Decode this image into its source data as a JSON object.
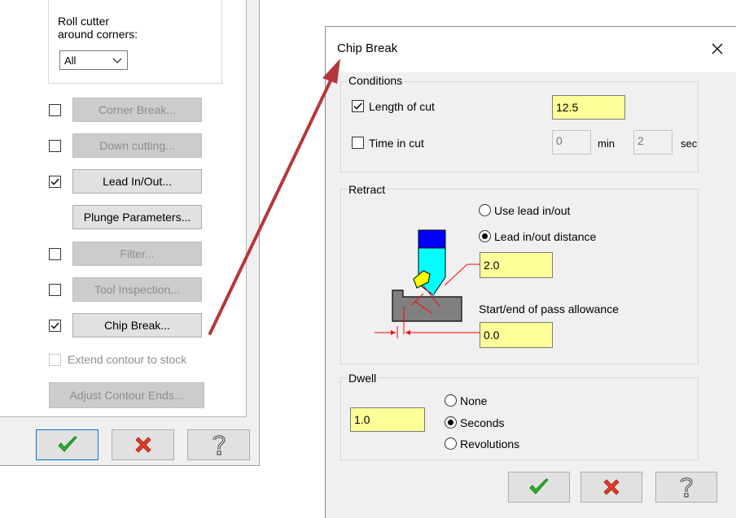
{
  "left_panel": {
    "roll_cutter_label": "Roll cutter\naround corners:",
    "roll_cutter_value": "All",
    "options": [
      {
        "label": "Corner Break...",
        "checked": false,
        "enabled": false
      },
      {
        "label": "Down cutting...",
        "checked": false,
        "enabled": false
      },
      {
        "label": "Lead In/Out...",
        "checked": true,
        "enabled": true
      },
      {
        "label": "Plunge Parameters...",
        "enabled": true
      },
      {
        "label": "Filter...",
        "checked": false,
        "enabled": false
      },
      {
        "label": "Tool Inspection...",
        "checked": false,
        "enabled": false
      },
      {
        "label": "Chip Break...",
        "checked": true,
        "enabled": true
      }
    ],
    "extend_contour_label": "Extend contour to stock",
    "adjust_contour_label": "Adjust Contour Ends...",
    "ok_icon": "green-check-icon",
    "cancel_icon": "red-x-icon",
    "help_icon": "question-mark-icon"
  },
  "dialog": {
    "title": "Chip Break",
    "close_glyph": "✕",
    "conditions": {
      "label": "Conditions",
      "length_of_cut_label": "Length of cut",
      "length_of_cut_checked": true,
      "length_of_cut_value": "12.5",
      "time_in_cut_label": "Time in cut",
      "time_in_cut_checked": false,
      "min_value": "0",
      "min_label": "min",
      "sec_value": "2",
      "sec_label": "sec"
    },
    "retract": {
      "label": "Retract",
      "use_lead_label": "Use lead in/out",
      "lead_distance_label": "Lead in/out distance",
      "selected": "Lead in/out distance",
      "lead_distance_value": "2.0",
      "allowance_label": "Start/end of pass allowance",
      "allowance_value": "0.0"
    },
    "dwell": {
      "label": "Dwell",
      "value": "1.0",
      "options": [
        "None",
        "Seconds",
        "Revolutions"
      ],
      "selected": "Seconds"
    },
    "ok_icon": "green-check-icon",
    "cancel_icon": "red-x-icon",
    "help_icon": "question-mark-icon"
  },
  "colors": {
    "arrow": "#b5373b",
    "field_yellow": "#ffff99",
    "tool_blue": "#0000ff",
    "tool_cyan": "#00ffff",
    "insert_yellow": "#ffff00",
    "stock_gray": "#808080",
    "dimension_red": "#ff0000",
    "check_green": "#2db52d",
    "cancel_red": "#e03b2a"
  }
}
